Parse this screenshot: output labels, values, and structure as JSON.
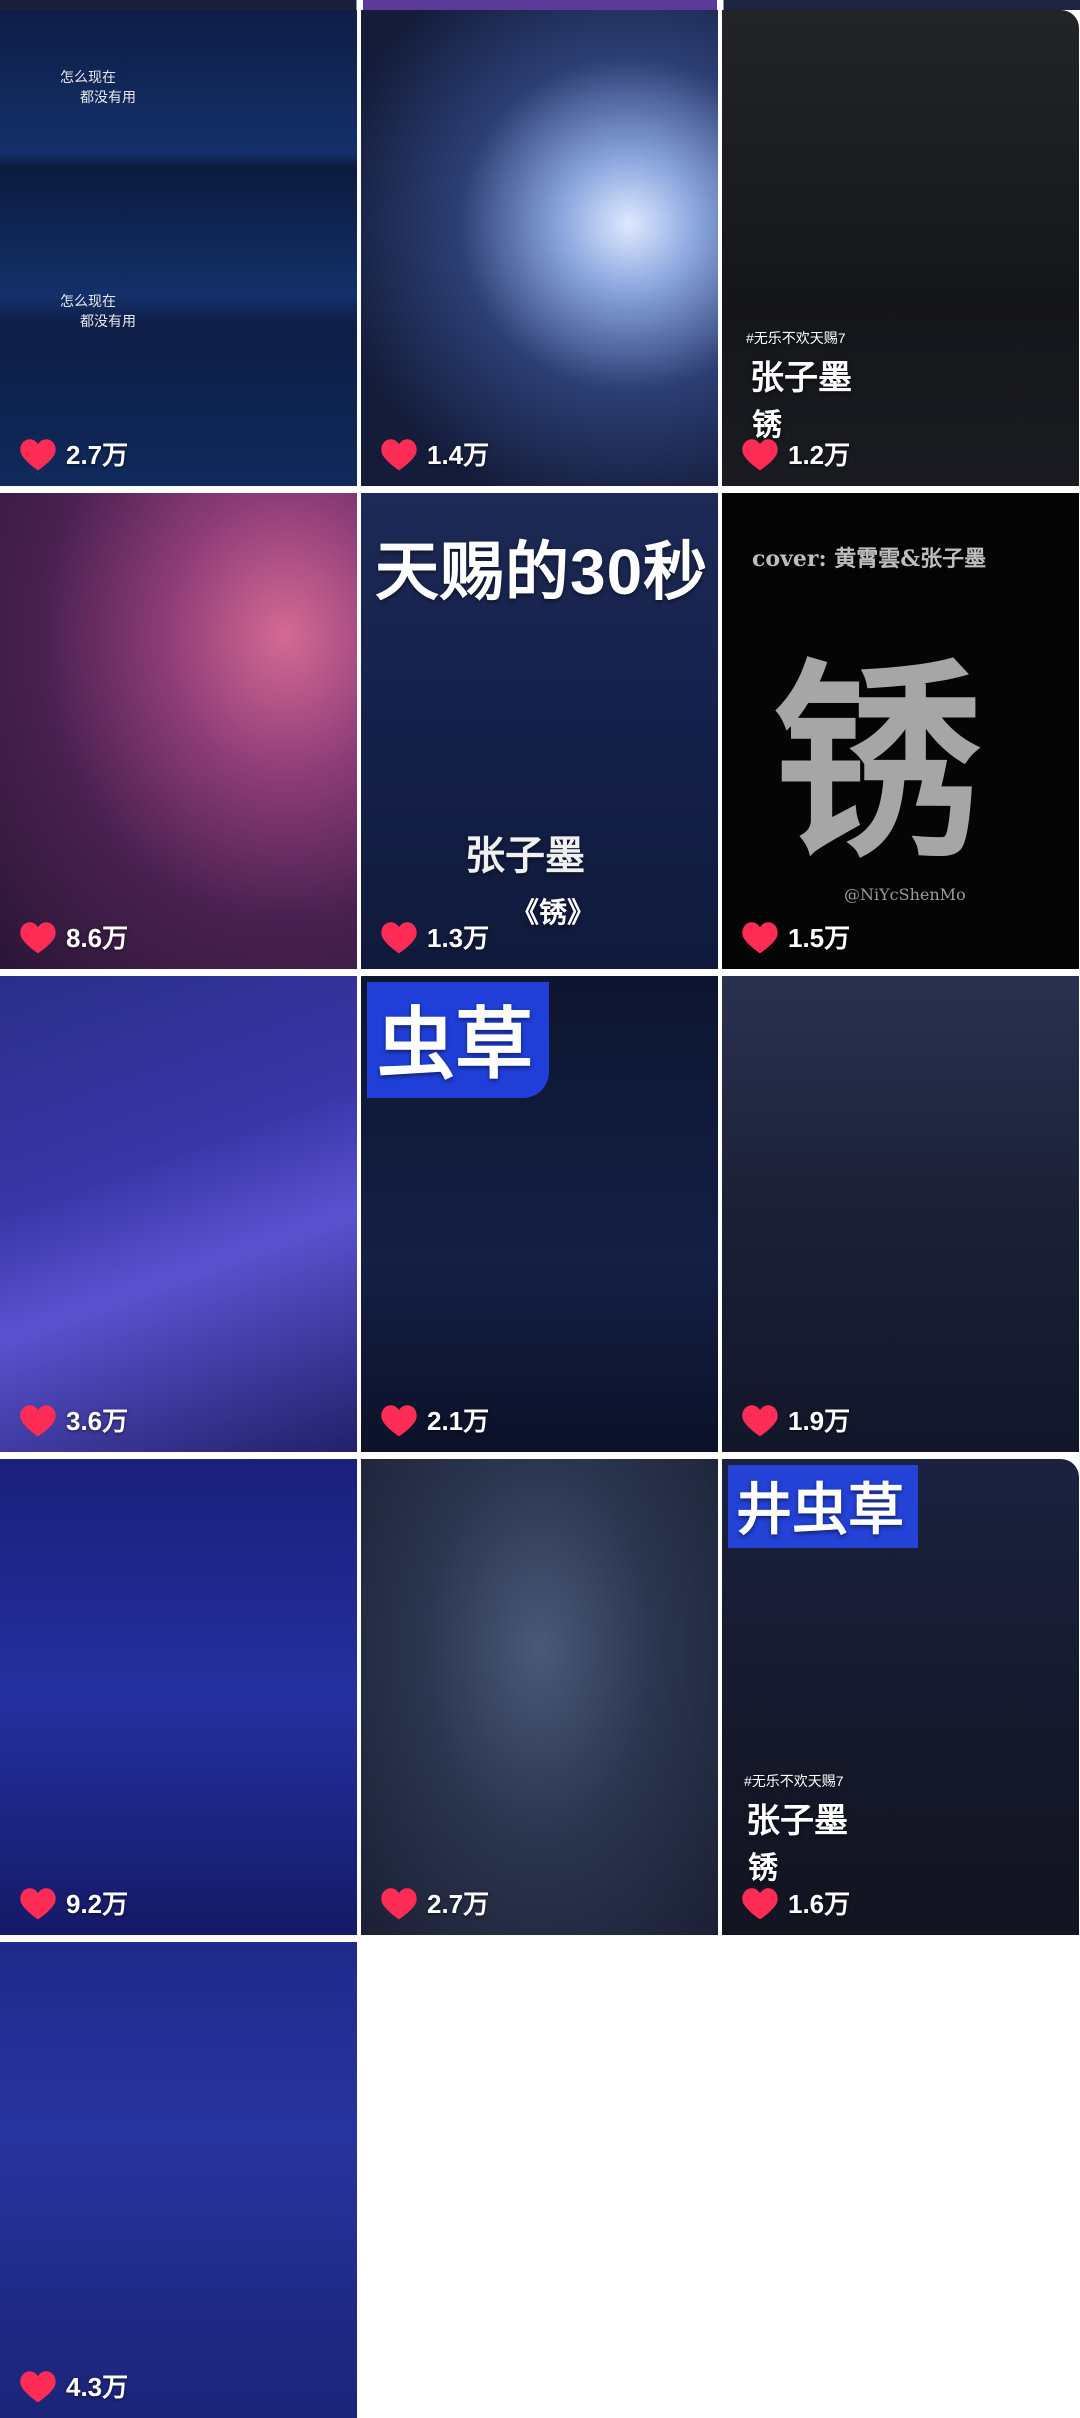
{
  "tiles": [
    {
      "likes": "2.7万",
      "caption1": "怎么现在",
      "caption2": "都没有用",
      "caption3": "怎么现在",
      "caption4": "都没有用"
    },
    {
      "likes": "1.4万"
    },
    {
      "likes": "1.2万",
      "tag": "#无乐不欢天赐7",
      "name": "张子墨",
      "song": "锈"
    },
    {
      "likes": "8.6万"
    },
    {
      "likes": "1.3万",
      "headline": "天赐的30秒",
      "name": "张子墨",
      "song": "《锈》"
    },
    {
      "likes": "1.5万",
      "cover": "cover: 黄霄雲&张子墨",
      "big_char": "锈",
      "watermark": "@NiYcShenMo"
    },
    {
      "likes": "3.6万"
    },
    {
      "likes": "2.1万",
      "sign": "虫草"
    },
    {
      "likes": "1.9万"
    },
    {
      "likes": "9.2万"
    },
    {
      "likes": "2.7万"
    },
    {
      "likes": "1.6万",
      "tag": "#无乐不欢天赐7",
      "name": "张子墨",
      "song": "锈",
      "sign": "井虫草"
    },
    {
      "likes": "4.3万"
    }
  ],
  "colors": {
    "heart": "#ff2d55",
    "orange": "#f08a1c",
    "teal": "#7cd3d6"
  }
}
